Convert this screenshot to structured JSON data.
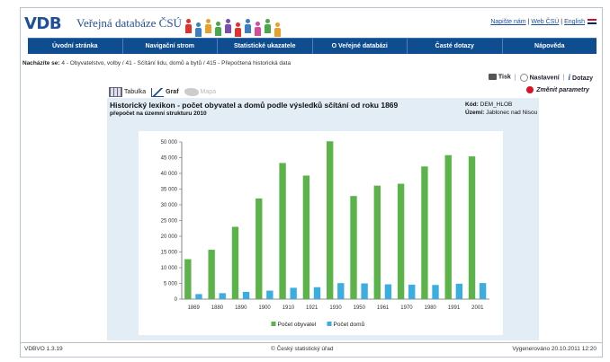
{
  "header": {
    "logo": "VDB",
    "title": "Veřejná databáze ČSÚ",
    "links": [
      "Napište nám",
      "Web ČSÚ",
      "English"
    ]
  },
  "nav": [
    "Úvodní stránka",
    "Navigační strom",
    "Statistické ukazatele",
    "O Veřejné databázi",
    "Časté dotazy",
    "Nápověda"
  ],
  "breadcrumb": {
    "label": "Nacházíte se:",
    "path": "4 - Obyvatelstvo, volby / 41 - Sčítání lidu, domů a bytů / 415 - Přepočtená historická data"
  },
  "tools": {
    "print": "Tisk",
    "settings": "Nastavení",
    "queries": "Dotazy",
    "change_params": "Změnit parametry"
  },
  "tabs": {
    "table": "Tabulka",
    "graph": "Graf",
    "map": "Mapa"
  },
  "content": {
    "title": "Historický lexikon - počet obyvatel a domů podle výsledků sčítání od roku 1869",
    "subtitle": "přepočet na územní strukturu 2010",
    "code_label": "Kód:",
    "code_value": "DEM_HLOB",
    "area_label": "Území:",
    "area_value": "Jablonec nad Nisou"
  },
  "chart_data": {
    "type": "bar",
    "categories": [
      "1869",
      "1880",
      "1890",
      "1900",
      "1910",
      "1921",
      "1930",
      "1950",
      "1961",
      "1970",
      "1980",
      "1991",
      "2001"
    ],
    "series": [
      {
        "name": "Počet obyvatel",
        "color": "#5cb34a",
        "values": [
          12700,
          15700,
          23000,
          32000,
          43300,
          39300,
          50200,
          32800,
          36100,
          36700,
          42200,
          45800,
          45400
        ]
      },
      {
        "name": "Počet domů",
        "color": "#3aaee0",
        "values": [
          1600,
          1900,
          2300,
          2700,
          3600,
          3800,
          5100,
          5000,
          4700,
          4600,
          4500,
          4900,
          5100
        ]
      }
    ],
    "yticks": [
      "0",
      "5 000",
      "10 000",
      "15 000",
      "20 000",
      "25 000",
      "30 000",
      "35 000",
      "40 000",
      "45 000",
      "50 000"
    ],
    "ylim": [
      0,
      50000
    ],
    "grid": false,
    "legend_position": "bottom"
  },
  "footer": {
    "version": "VDBVO 1.3.19",
    "copyright": "© Český statistický úřad",
    "generated": "Vygenerováno 20.10.2011 12:20"
  },
  "colors": {
    "nav_bg": "#0e4d8f",
    "brand": "#1f4f9a",
    "content_bg": "#e3edf5"
  }
}
